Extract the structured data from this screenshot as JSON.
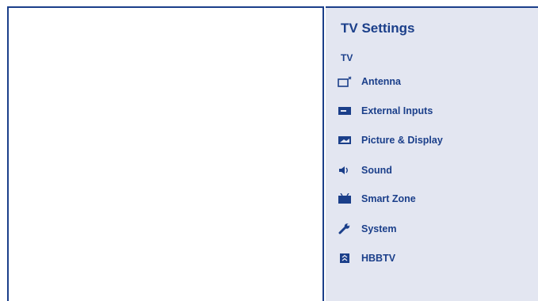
{
  "panel": {
    "title": "TV Settings",
    "section": "TV",
    "items": [
      {
        "label": "Antenna",
        "icon": "antenna-icon"
      },
      {
        "label": "External Inputs",
        "icon": "external-inputs-icon"
      },
      {
        "label": "Picture & Display",
        "icon": "picture-display-icon"
      },
      {
        "label": "Sound",
        "icon": "sound-icon"
      },
      {
        "label": "Smart Zone",
        "icon": "smart-zone-icon"
      },
      {
        "label": "System",
        "icon": "wrench-icon"
      },
      {
        "label": "HBBTV",
        "icon": "hbbtv-icon"
      }
    ]
  },
  "colors": {
    "accent": "#1b3f8a",
    "panel_bg": "#e3e6f1"
  }
}
